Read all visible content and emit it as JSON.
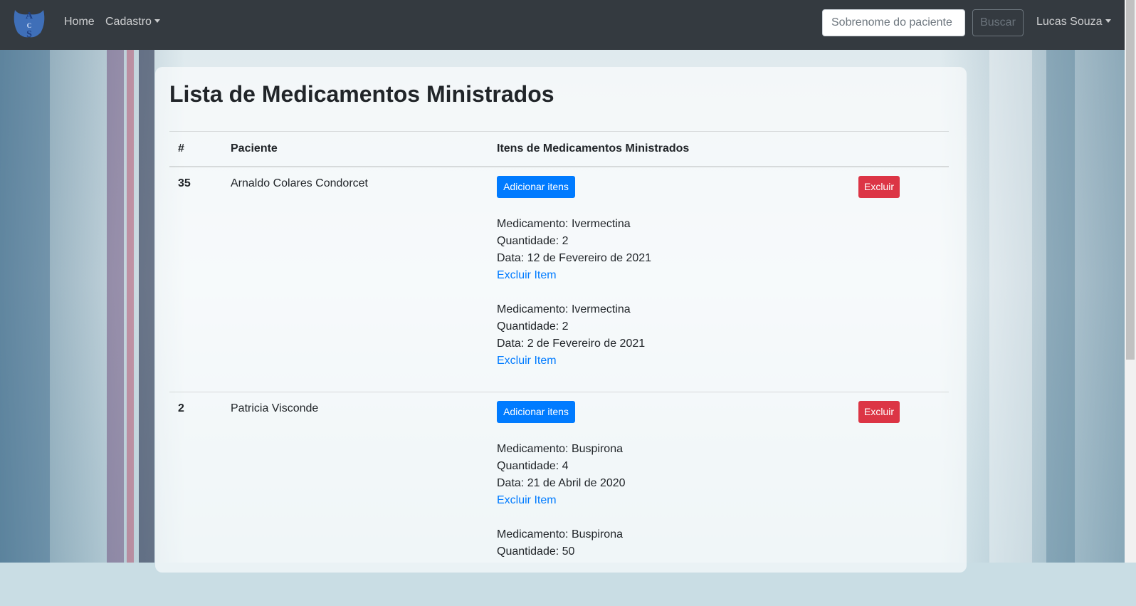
{
  "navbar": {
    "logo_text": "ACS",
    "home_label": "Home",
    "cadastro_label": "Cadastro",
    "search_placeholder": "Sobrenome do paciente",
    "search_button": "Buscar",
    "user_name": "Lucas Souza"
  },
  "page": {
    "title": "Lista de Medicamentos Ministrados"
  },
  "table": {
    "headers": [
      "#",
      "Paciente",
      "Itens de Medicamentos Ministrados"
    ],
    "add_button_label": "Adicionar itens",
    "delete_button_label": "Excluir",
    "delete_item_label": "Excluir Item",
    "rows": [
      {
        "id": "35",
        "paciente": "Arnaldo Colares Condorcet",
        "itens": [
          {
            "medicamento": "Medicamento: Ivermectina",
            "quantidade": "Quantidade: 2",
            "data": "Data: 12 de Fevereiro de 2021"
          },
          {
            "medicamento": "Medicamento: Ivermectina",
            "quantidade": "Quantidade: 2",
            "data": "Data: 2 de Fevereiro de 2021"
          }
        ]
      },
      {
        "id": "2",
        "paciente": "Patricia Visconde",
        "itens": [
          {
            "medicamento": "Medicamento: Buspirona",
            "quantidade": "Quantidade: 4",
            "data": "Data: 21 de Abril de 2020"
          },
          {
            "medicamento": "Medicamento: Buspirona",
            "quantidade": "Quantidade: 50",
            "data": ""
          }
        ]
      }
    ]
  },
  "colors": {
    "navbar_bg": "#343a40",
    "primary": "#007bff",
    "danger": "#dc3545"
  }
}
